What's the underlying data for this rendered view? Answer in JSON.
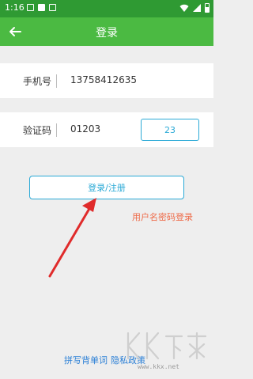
{
  "status_bar": {
    "time": "1:16",
    "notification_icons": [
      "image-icon",
      "a-icon",
      "keyboard-icon"
    ],
    "system_icons": [
      "wifi-icon",
      "signal-icon",
      "battery-icon"
    ]
  },
  "app_bar": {
    "back_icon": "back-arrow-icon",
    "title": "登录",
    "background": "#4bba42"
  },
  "form": {
    "phone": {
      "label": "手机号",
      "value": "13758412635"
    },
    "code": {
      "label": "验证码",
      "value": "01203",
      "button_label": "23"
    }
  },
  "actions": {
    "login_label": "登录/注册",
    "password_login_label": "用户名密码登录"
  },
  "footer": {
    "links": [
      "拼写背单词",
      "隐私政策"
    ]
  },
  "watermark": {
    "url": "www.kkx.net"
  },
  "colors": {
    "status_bar": "#2f9a33",
    "app_bar": "#4bba42",
    "accent": "#2aa9d6",
    "password_link": "#ee6a48",
    "footer_link": "#2a7fd6",
    "annotation_arrow": "#e02b2b"
  }
}
